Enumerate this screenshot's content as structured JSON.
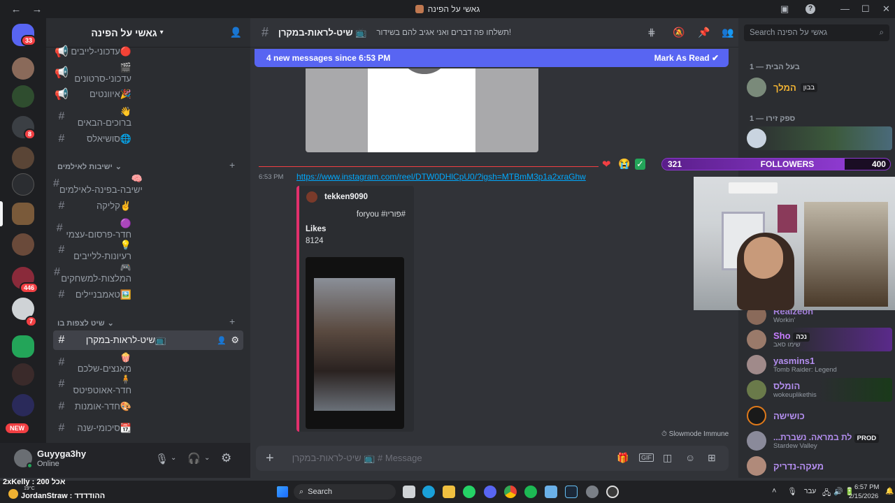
{
  "titlebar": {
    "title": "גאשי על הפינה"
  },
  "rail": {
    "home_badge": "33",
    "badges": [
      "8",
      "446",
      "7"
    ],
    "new_label": "NEW"
  },
  "sidebar": {
    "server_name": "גאשי על הפינה",
    "channels_top": [
      {
        "name": "עדכוני-לייבים",
        "emoji": "🔴",
        "icon": "megaphone"
      },
      {
        "name": "עדכוני-סרטונים",
        "emoji": "🎬",
        "icon": "megaphone"
      },
      {
        "name": "איוונטים",
        "emoji": "🎉",
        "icon": "megaphone"
      },
      {
        "name": "ברוכים-הבאים",
        "emoji": "👋",
        "icon": "hash"
      },
      {
        "name": "סושיאלס",
        "emoji": "🌐",
        "icon": "hash"
      }
    ],
    "category1": "ישיבות לאילמים",
    "channels_mid": [
      {
        "name": "ישיבה-בפינה-לאילמים",
        "emoji": "🧠"
      },
      {
        "name": "קליקה",
        "emoji": "✌️"
      },
      {
        "name": "חדר-פרסום-עצמי",
        "emoji": "🟣"
      },
      {
        "name": "רעיונות-ללייבים",
        "emoji": "💡"
      },
      {
        "name": "המלצות-למשחקים",
        "emoji": "🎮"
      },
      {
        "name": "טאמבניילים",
        "emoji": "🖼️"
      }
    ],
    "category2": "שיט לצפות בו",
    "channels_bot": [
      {
        "name": "שיט-לראות-במקרן",
        "emoji": "📺",
        "active": true
      },
      {
        "name": "מאנצים-שלכם",
        "emoji": "🍿"
      },
      {
        "name": "חדר-אאוטפיטס",
        "emoji": "🧍"
      },
      {
        "name": "חדר-אומנות",
        "emoji": "🎨"
      },
      {
        "name": "סיכומי-שנה",
        "emoji": "📆"
      }
    ]
  },
  "user": {
    "name": "Guyyga3hy",
    "status": "Online"
  },
  "chat": {
    "channel_name": "📺 שיט-לראות-במקרן",
    "topic": "!תשלחו פה דברים ואני אגיב להם בשידור",
    "newbar_text": "4 new messages since 6:53 PM",
    "mark_read": "Mark As Read",
    "msg_time": "6:53 PM",
    "link": "https://www.instagram.com/reel/DTW0DHlCpU0/?igsh=MTBmM3p1a2xraGhw",
    "embed_author": "tekken9090",
    "embed_caption": "foryou #פוריו#",
    "embed_field_name": "Likes",
    "embed_field_value": "8124",
    "slowmode": "Slowmode Immune",
    "composer_placeholder": "Message # 📺 שיט-לראות-במקרן"
  },
  "members": {
    "search_placeholder": "Search גאשי על הפינה",
    "group1": "בעל הבית — 1",
    "owner_name": "המלך",
    "owner_tag": "בבון",
    "group2": "ספק זירו — 1",
    "list": [
      {
        "name": "Realzeon",
        "activity": "Workin'",
        "color": "#a27fd9"
      },
      {
        "name": "Sho",
        "tag": "נכה",
        "activity": "שימו סאב",
        "color": "#c77dff"
      },
      {
        "name": "yasmins1",
        "activity": "Tomb Raider: Legend",
        "color": "#b48ef0"
      },
      {
        "name": "הומלס",
        "activity": "wokeuplikethis",
        "color": "#b48ef0"
      },
      {
        "name": "כושישה",
        "activity": "",
        "color": "#b48ef0"
      },
      {
        "name": "...לת במראה. נשברת",
        "tag": "PROD",
        "activity": "Stardew Valley",
        "color": "#b48ef0"
      },
      {
        "name": "מעקה-נדריק",
        "activity": "",
        "color": "#b48ef0"
      }
    ]
  },
  "overlay": {
    "followers_current": "321",
    "followers_label": "FOLLOWERS",
    "followers_goal": "400",
    "followers_fraction": 0.8
  },
  "taskbar": {
    "ticker_line1": "2xKelly : אכל 200",
    "ticker_line2": "JordanStraw : ההודדדד",
    "ticker_temp": "19°C",
    "search": "Search",
    "lang": "עבר",
    "time": "6:57 PM",
    "date": "2/15/2026"
  }
}
